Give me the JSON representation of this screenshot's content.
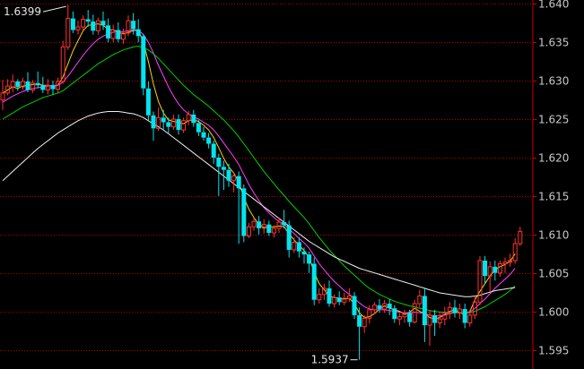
{
  "chart_data": {
    "type": "candlestick",
    "y_axis": {
      "position": "right",
      "ylim": [
        1.5925,
        1.6405
      ],
      "ticks": [
        1.64,
        1.635,
        1.63,
        1.625,
        1.62,
        1.615,
        1.61,
        1.605,
        1.6,
        1.595
      ],
      "tick_labels": [
        "1.640",
        "1.635",
        "1.630",
        "1.625",
        "1.620",
        "1.615",
        "1.610",
        "1.605",
        "1.600",
        "1.595"
      ]
    },
    "grid": "horizontal dotted red",
    "colors": {
      "background": "#000000",
      "up_candle": "#ff3232",
      "down_candle": "#00e5ee",
      "grid": "#b40000",
      "axis_line": "#c80000",
      "label_text": "#c8c8c8",
      "ma_fast": "#ffd400",
      "ma_mid": "#ff40ff",
      "ma_slow": "#00d000",
      "ma_long": "#f0f0f0"
    },
    "annotations": [
      {
        "label": "1.6399",
        "value": 1.6399,
        "type": "max"
      },
      {
        "label": "1.5937",
        "value": 1.5937,
        "type": "min"
      }
    ],
    "candles": [
      [
        1.6275,
        1.6301,
        1.6284,
        1.6262
      ],
      [
        1.6284,
        1.6302,
        1.6293,
        1.6281
      ],
      [
        1.6292,
        1.6308,
        1.6299,
        1.6285
      ],
      [
        1.6299,
        1.6302,
        1.6292,
        1.6287
      ],
      [
        1.6292,
        1.6304,
        1.6299,
        1.6288
      ],
      [
        1.6299,
        1.6311,
        1.6288,
        1.6285
      ],
      [
        1.6288,
        1.6301,
        1.6297,
        1.6284
      ],
      [
        1.6297,
        1.6312,
        1.6294,
        1.629
      ],
      [
        1.6294,
        1.6305,
        1.6288,
        1.6284
      ],
      [
        1.6288,
        1.6302,
        1.6294,
        1.6282
      ],
      [
        1.6294,
        1.63,
        1.6289,
        1.6282
      ],
      [
        1.6289,
        1.6304,
        1.6299,
        1.6284
      ],
      [
        1.6299,
        1.6352,
        1.6344,
        1.6296
      ],
      [
        1.6344,
        1.6399,
        1.6381,
        1.634
      ],
      [
        1.6381,
        1.639,
        1.6366,
        1.6362
      ],
      [
        1.6366,
        1.6378,
        1.637,
        1.636
      ],
      [
        1.637,
        1.6385,
        1.638,
        1.6366
      ],
      [
        1.638,
        1.6392,
        1.6377,
        1.637
      ],
      [
        1.6377,
        1.6386,
        1.6365,
        1.636
      ],
      [
        1.6365,
        1.6382,
        1.6378,
        1.636
      ],
      [
        1.6378,
        1.639,
        1.6372,
        1.6366
      ],
      [
        1.6372,
        1.6381,
        1.6355,
        1.635
      ],
      [
        1.6355,
        1.6373,
        1.6366,
        1.635
      ],
      [
        1.6366,
        1.6376,
        1.6354,
        1.635
      ],
      [
        1.6354,
        1.6368,
        1.6362,
        1.6348
      ],
      [
        1.6362,
        1.6385,
        1.6378,
        1.6358
      ],
      [
        1.6378,
        1.6388,
        1.6367,
        1.636
      ],
      [
        1.6367,
        1.638,
        1.6358,
        1.635
      ],
      [
        1.6358,
        1.6361,
        1.629,
        1.6281
      ],
      [
        1.629,
        1.6299,
        1.6255,
        1.6248
      ],
      [
        1.6255,
        1.626,
        1.6238,
        1.6222
      ],
      [
        1.6238,
        1.6265,
        1.6252,
        1.6235
      ],
      [
        1.6252,
        1.6262,
        1.6246,
        1.6236
      ],
      [
        1.6246,
        1.6252,
        1.624,
        1.6231
      ],
      [
        1.624,
        1.6256,
        1.625,
        1.6236
      ],
      [
        1.625,
        1.6256,
        1.6236,
        1.623
      ],
      [
        1.6236,
        1.6252,
        1.6248,
        1.6232
      ],
      [
        1.6248,
        1.6261,
        1.6256,
        1.6242
      ],
      [
        1.6256,
        1.6262,
        1.6245,
        1.624
      ],
      [
        1.6245,
        1.6249,
        1.6233,
        1.6228
      ],
      [
        1.6233,
        1.624,
        1.6226,
        1.6222
      ],
      [
        1.6226,
        1.6232,
        1.6218,
        1.6212
      ],
      [
        1.6218,
        1.6222,
        1.62,
        1.6192
      ],
      [
        1.62,
        1.6205,
        1.6188,
        1.615
      ],
      [
        1.6188,
        1.6196,
        1.6184,
        1.6158
      ],
      [
        1.6184,
        1.6192,
        1.617,
        1.6162
      ],
      [
        1.617,
        1.618,
        1.6176,
        1.6155
      ],
      [
        1.6176,
        1.6182,
        1.616,
        1.6088
      ],
      [
        1.616,
        1.6165,
        1.6098,
        1.609
      ],
      [
        1.6098,
        1.6115,
        1.611,
        1.6095
      ],
      [
        1.611,
        1.6122,
        1.6117,
        1.6105
      ],
      [
        1.6117,
        1.6124,
        1.6108,
        1.61
      ],
      [
        1.6108,
        1.612,
        1.6113,
        1.6101
      ],
      [
        1.6113,
        1.6118,
        1.6102,
        1.6098
      ],
      [
        1.6102,
        1.6112,
        1.6108,
        1.6096
      ],
      [
        1.6108,
        1.6122,
        1.6116,
        1.6102
      ],
      [
        1.6116,
        1.6132,
        1.6112,
        1.6108
      ],
      [
        1.6112,
        1.6118,
        1.608,
        1.607
      ],
      [
        1.608,
        1.6096,
        1.609,
        1.6076
      ],
      [
        1.609,
        1.6096,
        1.6078,
        1.607
      ],
      [
        1.6078,
        1.6083,
        1.6074,
        1.6062
      ],
      [
        1.6074,
        1.6078,
        1.6062,
        1.605
      ],
      [
        1.6062,
        1.607,
        1.6015,
        1.6008
      ],
      [
        1.6015,
        1.603,
        1.6022,
        1.601
      ],
      [
        1.6022,
        1.6036,
        1.603,
        1.6015
      ],
      [
        1.603,
        1.604,
        1.601,
        1.6006
      ],
      [
        1.601,
        1.6022,
        1.6018,
        1.6005
      ],
      [
        1.6018,
        1.6026,
        1.6012,
        1.6008
      ],
      [
        1.6012,
        1.6024,
        1.6017,
        1.6008
      ],
      [
        1.6017,
        1.603,
        1.602,
        1.6012
      ],
      [
        1.602,
        1.6025,
        1.5995,
        1.599
      ],
      [
        1.5995,
        1.6005,
        1.598,
        1.5937
      ],
      [
        1.598,
        1.5995,
        1.5991,
        1.5972
      ],
      [
        1.5991,
        1.6008,
        1.6002,
        1.5984
      ],
      [
        1.6002,
        1.6012,
        1.6008,
        1.5996
      ],
      [
        1.6008,
        1.6016,
        1.6003,
        1.5998
      ],
      [
        1.6003,
        1.6015,
        1.601,
        1.5998
      ],
      [
        1.601,
        1.6016,
        1.6004,
        1.5995
      ],
      [
        1.6004,
        1.6008,
        1.599,
        1.5985
      ],
      [
        1.599,
        1.5998,
        1.5993,
        1.5982
      ],
      [
        1.5993,
        1.6002,
        1.5998,
        1.5985
      ],
      [
        1.5998,
        1.6002,
        1.5986,
        1.598
      ],
      [
        1.5986,
        1.6015,
        1.601,
        1.5984
      ],
      [
        1.601,
        1.6028,
        1.602,
        1.6005
      ],
      [
        1.602,
        1.603,
        1.5982,
        1.596
      ],
      [
        1.5982,
        1.6002,
        1.5995,
        1.5955
      ],
      [
        1.5995,
        1.6002,
        1.5985,
        1.5968
      ],
      [
        1.5985,
        1.6,
        1.599,
        1.5978
      ],
      [
        1.599,
        1.6006,
        1.5998,
        1.5982
      ],
      [
        1.5998,
        1.6012,
        1.6005,
        1.599
      ],
      [
        1.6005,
        1.6015,
        1.5998,
        1.5992
      ],
      [
        1.5998,
        1.601,
        1.6003,
        1.599
      ],
      [
        1.6003,
        1.601,
        1.5985,
        1.5978
      ],
      [
        1.5985,
        1.6002,
        1.5995,
        1.598
      ],
      [
        1.5995,
        1.602,
        1.6012,
        1.599
      ],
      [
        1.6012,
        1.6072,
        1.6066,
        1.6008
      ],
      [
        1.6066,
        1.6072,
        1.6046,
        1.6035
      ],
      [
        1.6046,
        1.6065,
        1.6058,
        1.6025
      ],
      [
        1.6058,
        1.6066,
        1.605,
        1.604
      ],
      [
        1.605,
        1.6066,
        1.6062,
        1.6045
      ],
      [
        1.6062,
        1.607,
        1.6064,
        1.605
      ],
      [
        1.6064,
        1.6075,
        1.6066,
        1.6058
      ],
      [
        1.6066,
        1.6095,
        1.6088,
        1.6062
      ],
      [
        1.6088,
        1.611,
        1.6104,
        1.6085
      ]
    ],
    "moving_averages": [
      {
        "color_key": "ma_fast",
        "values": [
          1.6284,
          1.6288,
          1.6292,
          1.629,
          1.6293,
          1.6294,
          1.6295,
          1.6296,
          1.6294,
          1.6294,
          1.6293,
          1.6294,
          1.6305,
          1.6322,
          1.6339,
          1.6352,
          1.6365,
          1.6372,
          1.6373,
          1.6374,
          1.6372,
          1.6367,
          1.6366,
          1.6363,
          1.6361,
          1.6363,
          1.6365,
          1.6366,
          1.635,
          1.6325,
          1.6296,
          1.6273,
          1.6258,
          1.6249,
          1.6247,
          1.6246,
          1.6244,
          1.6248,
          1.6249,
          1.6247,
          1.6242,
          1.6236,
          1.6226,
          1.6213,
          1.6199,
          1.6188,
          1.618,
          1.6168,
          1.6148,
          1.6133,
          1.6122,
          1.6113,
          1.6109,
          1.611,
          1.611,
          1.6111,
          1.611,
          1.6101,
          1.6093,
          1.6086,
          1.6079,
          1.607,
          1.6051,
          1.6036,
          1.6028,
          1.602,
          1.6018,
          1.6017,
          1.6016,
          1.6017,
          1.601,
          1.5998,
          1.5992,
          1.5993,
          1.5997,
          1.6003,
          1.6007,
          1.6004,
          1.6002,
          1.6,
          1.5996,
          1.5999,
          1.6004,
          1.6,
          1.5997,
          1.5992,
          1.599,
          1.5992,
          1.5996,
          1.6,
          1.6002,
          1.5998,
          1.5996,
          1.6,
          1.6015,
          1.6026,
          1.6036,
          1.6046,
          1.6054,
          1.6058,
          1.6061,
          1.6065,
          1.6075
        ]
      },
      {
        "color_key": "ma_mid",
        "values": [
          1.6272,
          1.6276,
          1.628,
          1.6283,
          1.6286,
          1.6288,
          1.629,
          1.6291,
          1.6292,
          1.6293,
          1.6294,
          1.6294,
          1.6298,
          1.6306,
          1.6315,
          1.6324,
          1.6333,
          1.6341,
          1.6348,
          1.6354,
          1.6358,
          1.6361,
          1.6363,
          1.6364,
          1.6364,
          1.6365,
          1.6366,
          1.6366,
          1.636,
          1.635,
          1.6336,
          1.632,
          1.6306,
          1.6292,
          1.628,
          1.627,
          1.6262,
          1.6257,
          1.6253,
          1.625,
          1.6246,
          1.6242,
          1.6236,
          1.6228,
          1.6219,
          1.621,
          1.6201,
          1.6191,
          1.6178,
          1.6165,
          1.6154,
          1.6144,
          1.6135,
          1.6128,
          1.6122,
          1.6117,
          1.6113,
          1.6107,
          1.6101,
          1.6095,
          1.6089,
          1.6082,
          1.6072,
          1.6062,
          1.6054,
          1.6046,
          1.6039,
          1.6033,
          1.6027,
          1.6022,
          1.6017,
          1.6011,
          1.6006,
          1.6003,
          1.6002,
          1.6002,
          1.6002,
          1.6001,
          1.6,
          1.5999,
          1.5998,
          1.5998,
          1.5999,
          1.5998,
          1.5997,
          1.5995,
          1.5994,
          1.5994,
          1.5995,
          1.5997,
          1.5998,
          1.5998,
          1.5998,
          1.5999,
          1.6004,
          1.601,
          1.6016,
          1.6023,
          1.603,
          1.6036,
          1.6042,
          1.6048,
          1.6056
        ]
      },
      {
        "color_key": "ma_slow",
        "values": [
          1.625,
          1.6254,
          1.6258,
          1.6262,
          1.6266,
          1.6269,
          1.6272,
          1.6275,
          1.6278,
          1.628,
          1.6282,
          1.6284,
          1.6287,
          1.6292,
          1.6297,
          1.6302,
          1.6307,
          1.6312,
          1.6317,
          1.6322,
          1.6326,
          1.633,
          1.6334,
          1.6337,
          1.634,
          1.6342,
          1.6344,
          1.6345,
          1.6343,
          1.634,
          1.6335,
          1.6329,
          1.6322,
          1.6315,
          1.6308,
          1.6301,
          1.6294,
          1.6288,
          1.6282,
          1.6277,
          1.6272,
          1.6267,
          1.6261,
          1.6255,
          1.6249,
          1.6242,
          1.6235,
          1.6227,
          1.6218,
          1.6209,
          1.62,
          1.6191,
          1.6182,
          1.6174,
          1.6166,
          1.6158,
          1.6151,
          1.6143,
          1.6136,
          1.6129,
          1.6122,
          1.6114,
          1.6105,
          1.6096,
          1.6088,
          1.608,
          1.6073,
          1.6066,
          1.6059,
          1.6053,
          1.6047,
          1.6041,
          1.6035,
          1.603,
          1.6026,
          1.6022,
          1.6019,
          1.6016,
          1.6013,
          1.6011,
          1.6009,
          1.6007,
          1.6006,
          1.6004,
          1.6003,
          1.6001,
          1.6,
          1.5999,
          1.5999,
          1.5998,
          1.5998,
          1.5998,
          1.5998,
          1.5998,
          1.6,
          1.6003,
          1.6006,
          1.601,
          1.6014,
          1.6018,
          1.6022,
          1.6027,
          1.6033
        ]
      },
      {
        "color_key": "ma_long",
        "values": [
          1.617,
          1.6176,
          1.6182,
          1.6188,
          1.6194,
          1.62,
          1.6206,
          1.6212,
          1.6217,
          1.6222,
          1.6227,
          1.6232,
          1.6236,
          1.624,
          1.6244,
          1.6248,
          1.6251,
          1.6254,
          1.6256,
          1.6258,
          1.6259,
          1.626,
          1.626,
          1.626,
          1.6259,
          1.6258,
          1.6257,
          1.6255,
          1.6252,
          1.6248,
          1.6244,
          1.624,
          1.6236,
          1.6231,
          1.6226,
          1.6221,
          1.6216,
          1.6211,
          1.6206,
          1.6201,
          1.6196,
          1.6191,
          1.6186,
          1.6181,
          1.6176,
          1.6171,
          1.6166,
          1.6161,
          1.6156,
          1.6151,
          1.6146,
          1.6141,
          1.6136,
          1.6131,
          1.6126,
          1.6121,
          1.6116,
          1.6111,
          1.6106,
          1.6101,
          1.6096,
          1.6091,
          1.6087,
          1.6083,
          1.6079,
          1.6075,
          1.6071,
          1.6068,
          1.6065,
          1.6062,
          1.6059,
          1.6056,
          1.6054,
          1.6052,
          1.605,
          1.6048,
          1.6046,
          1.6044,
          1.6042,
          1.604,
          1.6038,
          1.6036,
          1.6034,
          1.6032,
          1.603,
          1.6028,
          1.6026,
          1.6024,
          1.6023,
          1.6022,
          1.6021,
          1.602,
          1.6019,
          1.6019,
          1.602,
          1.6021,
          1.6023,
          1.6025,
          1.6027,
          1.6028,
          1.6029,
          1.603,
          1.6031
        ]
      }
    ]
  }
}
